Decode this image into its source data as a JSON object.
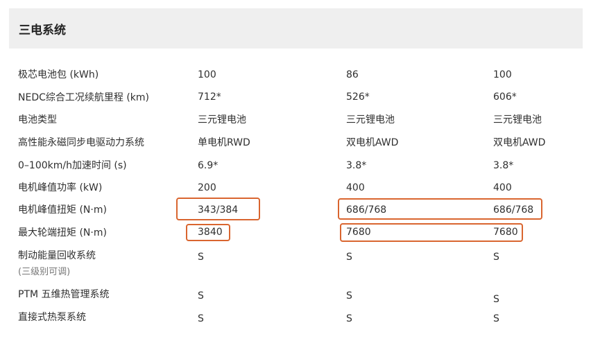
{
  "section": {
    "title": "三电系统"
  },
  "rows": [
    {
      "label": "极芯电池包 (kWh)",
      "values": [
        "100",
        "86",
        "100"
      ]
    },
    {
      "label": "NEDC综合工况续航里程 (km)",
      "values": [
        "712*",
        "526*",
        "606*"
      ]
    },
    {
      "label": "电池类型",
      "values": [
        "三元锂电池",
        "三元锂电池",
        "三元锂电池"
      ]
    },
    {
      "label": "高性能永磁同步电驱动力系统",
      "values": [
        "单电机RWD",
        "双电机AWD",
        "双电机AWD"
      ]
    },
    {
      "label": "0–100km/h加速时间 (s)",
      "values": [
        "6.9*",
        "3.8*",
        "3.8*"
      ]
    },
    {
      "label": "电机峰值功率 (kW)",
      "values": [
        "200",
        "400",
        "400"
      ]
    },
    {
      "label": "电机峰值扭矩 (N·m)",
      "values": [
        "343/384",
        "686/768",
        "686/768"
      ]
    },
    {
      "label": "最大轮端扭矩 (N·m)",
      "values": [
        "3840",
        "7680",
        "7680"
      ]
    },
    {
      "label": "制动能量回收系统",
      "sublabel": "(三级别可调)",
      "values": [
        "S",
        "S",
        "S"
      ]
    },
    {
      "label": "PTM 五维热管理系统",
      "values": [
        "S",
        "S",
        "S"
      ]
    },
    {
      "label": "直接式热泵系统",
      "values": [
        "S",
        "S",
        "S"
      ]
    }
  ],
  "highlight_color": "#d9652f"
}
